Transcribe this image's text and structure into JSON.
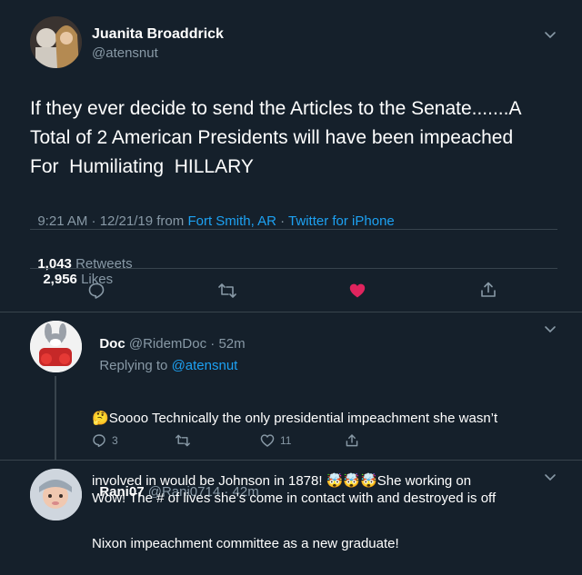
{
  "main_tweet": {
    "author_name": "Juanita Broaddrick",
    "handle": "@atensnut",
    "text_line1": "If they ever decide to send the Articles to the Senate.......A",
    "text_line2": "Total of 2 American Presidents will have been impeached",
    "text_line3": "For  Humiliating  HILLARY",
    "time": "9:21 AM · 12/21/19 from ",
    "location": "Fort Smith, AR",
    "separator": " · ",
    "source": "Twitter for iPhone",
    "retweets_count": "1,043",
    "retweets_label": "Retweets",
    "likes_count": "2,956",
    "likes_label": "Likes",
    "liked": true
  },
  "replies": [
    {
      "author_name": "Doc",
      "handle": "@RidemDoc",
      "age": "· 52m",
      "replying_to_label": "Replying to ",
      "replying_to": "@atensnut",
      "line1": "Soooo Technically the only presidential impeachment she wasn’t",
      "line2_a": "involved in would be Johnson in 1878! ",
      "line2_emoji": "🤯🤯🤯",
      "line2_b": "She working on",
      "line3": "Nixon impeachment committee as a new graduate!",
      "thinking_emoji": "🤔",
      "reply_count": "3",
      "like_count": "11"
    },
    {
      "author_name": "Rani07",
      "handle": "@Rani0714",
      "age": "· 42m",
      "line1": "Wow! The # of lives she’s come in contact with and destroyed is off"
    }
  ],
  "colors": {
    "background": "#15202b",
    "muted": "#8899a6",
    "link": "#1da1f2",
    "like": "#e0245e",
    "divider": "#38444d"
  },
  "icons": [
    "chevron-down-icon",
    "reply-icon",
    "retweet-icon",
    "heart-icon",
    "share-icon"
  ]
}
